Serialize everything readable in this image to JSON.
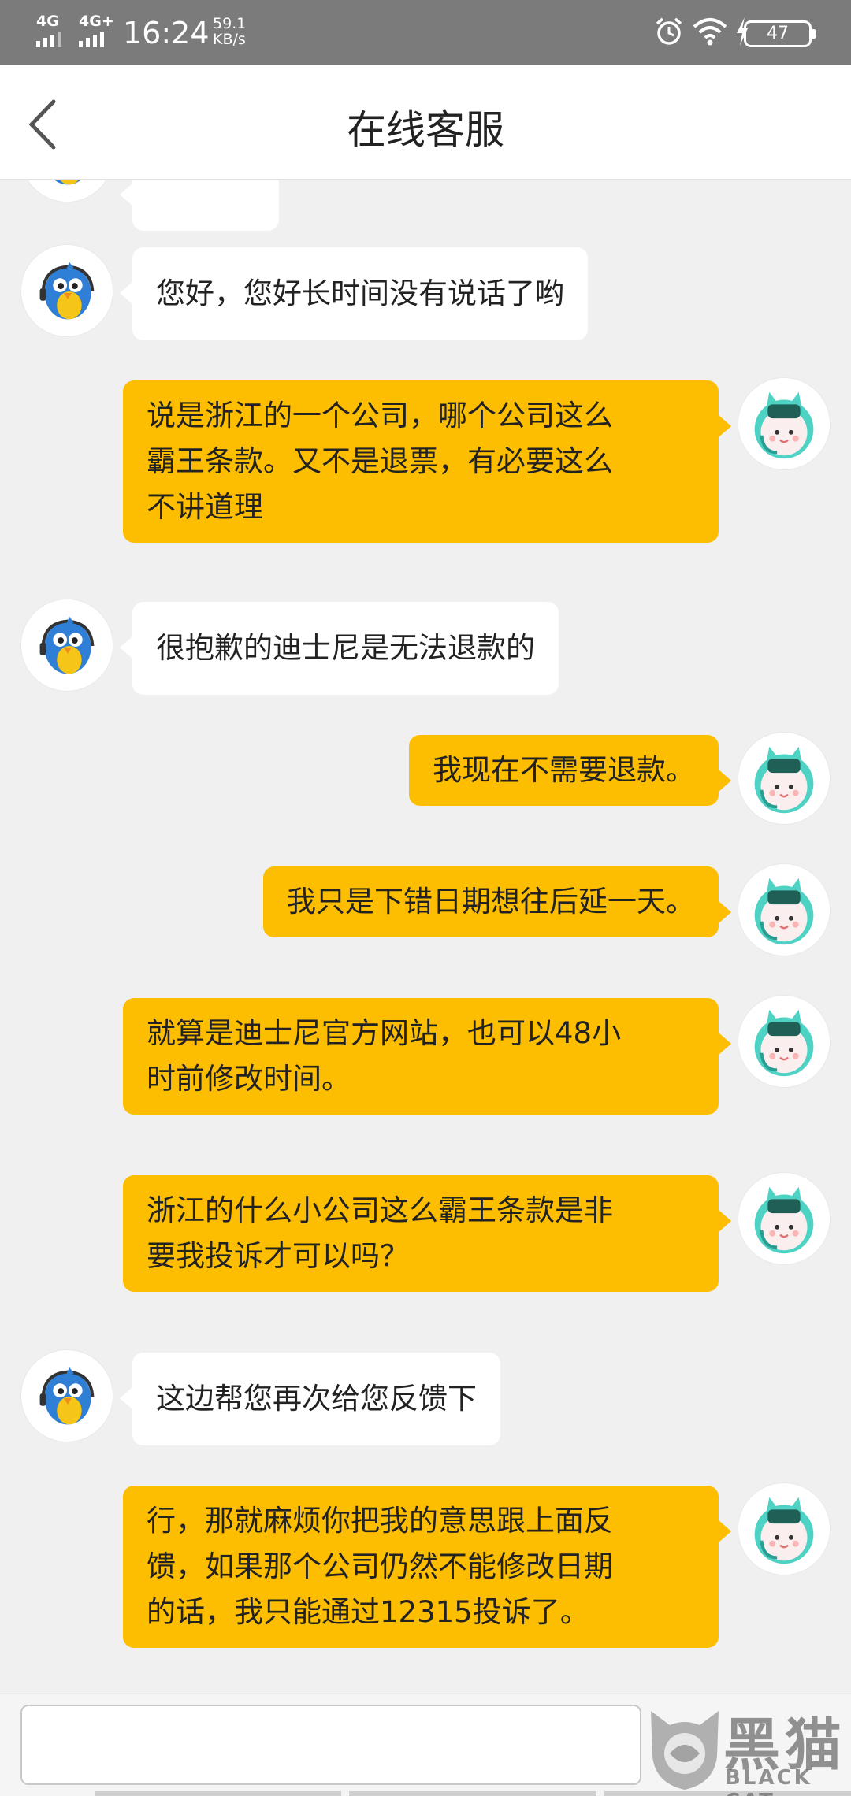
{
  "status_bar": {
    "network1": "4G",
    "network2": "4G+",
    "time": "16:24",
    "speed_value": "59.1",
    "speed_unit": "KB/s",
    "battery": "47",
    "icons": [
      "alarm-icon",
      "wifi-icon",
      "charging-icon",
      "battery-icon"
    ]
  },
  "header": {
    "title": "在线客服",
    "back_icon": "chevron-left-icon"
  },
  "colors": {
    "status_bar_bg": "#7b7b7b",
    "outgoing_bubble": "#fdbd00",
    "incoming_bubble": "#ffffff",
    "chat_bg": "#f0f0f0"
  },
  "messages": [
    {
      "from": "agent",
      "lines": [
        "您好，您好长时间没有说话了哟"
      ]
    },
    {
      "from": "user",
      "lines": [
        "说是浙江的一个公司，哪个公司这么",
        "霸王条款。又不是退票，有必要这么",
        "不讲道理"
      ]
    },
    {
      "from": "agent",
      "lines": [
        "很抱歉的迪士尼是无法退款的"
      ]
    },
    {
      "from": "user",
      "lines": [
        "我现在不需要退款。"
      ]
    },
    {
      "from": "user",
      "lines": [
        "我只是下错日期想往后延一天。"
      ]
    },
    {
      "from": "user",
      "lines": [
        "就算是迪士尼官方网站，也可以48小",
        "时前修改时间。"
      ]
    },
    {
      "from": "user",
      "lines": [
        "浙江的什么小公司这么霸王条款是非",
        "要我投诉才可以吗？"
      ]
    },
    {
      "from": "agent",
      "lines": [
        "这边帮您再次给您反馈下"
      ]
    },
    {
      "from": "user",
      "lines": [
        "行，那就麻烦你把我的意思跟上面反",
        "馈，如果那个公司仍然不能修改日期",
        "的话，我只能通过12315投诉了。"
      ]
    }
  ],
  "input": {
    "value": "",
    "placeholder": ""
  },
  "watermark": {
    "chinese": "黑猫",
    "english": "BLACK CAT"
  }
}
